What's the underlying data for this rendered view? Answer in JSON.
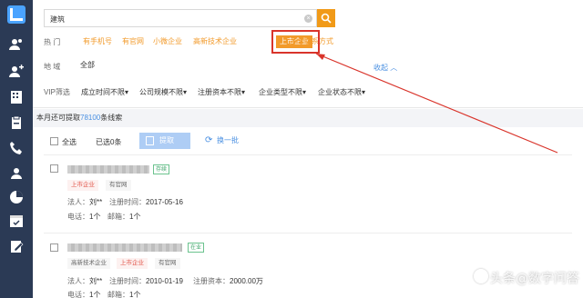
{
  "search": {
    "value": "建筑",
    "clear_icon": "clear-icon",
    "button_icon": "search-icon"
  },
  "hot": {
    "label": "热   门",
    "tags": [
      "有手机号",
      "有官网",
      "小微企业",
      "高新技术企业",
      "上市企业",
      "多个联系方式"
    ]
  },
  "region": {
    "label": "地   域",
    "value": "全部",
    "collapse_label": "收起"
  },
  "vip": {
    "label": "VIP筛选",
    "filters": [
      "成立时间不限",
      "公司规模不限",
      "注册资本不限",
      "企业类型不限",
      "企业状态不限"
    ]
  },
  "quota": {
    "prefix": "本月还可提取",
    "count": "78100",
    "suffix": "条线索"
  },
  "toolbar": {
    "select_all": "全选",
    "selected": "已选0条",
    "extract": "提取",
    "refresh": "换一批"
  },
  "results": [
    {
      "status": "存续",
      "tags": [
        "上市企业",
        "有官网"
      ],
      "legal_label": "法人：",
      "legal_value": "刘**",
      "reg_time_label": "注册时间：",
      "reg_time_value": "2017-05-16",
      "reg_capital_label": "",
      "reg_capital_value": "",
      "phone_label": "电话：",
      "phone_value": "1个",
      "email_label": "邮箱：",
      "email_value": "1个"
    },
    {
      "status": "在业",
      "tags": [
        "高新技术企业",
        "上市企业",
        "有官网"
      ],
      "legal_label": "法人：",
      "legal_value": "刘**",
      "reg_time_label": "注册时间：",
      "reg_time_value": "2010-01-19",
      "reg_capital_label": "注册资本：",
      "reg_capital_value": "2000.00万",
      "phone_label": "电话：",
      "phone_value": "1个",
      "email_label": "邮箱：",
      "email_value": "1个"
    }
  ],
  "watermark": "头条@数字问答",
  "colors": {
    "accent": "#f29a2a",
    "link": "#4a90e2",
    "highlight": "#d9342b",
    "sidebar": "#2b3a55"
  }
}
